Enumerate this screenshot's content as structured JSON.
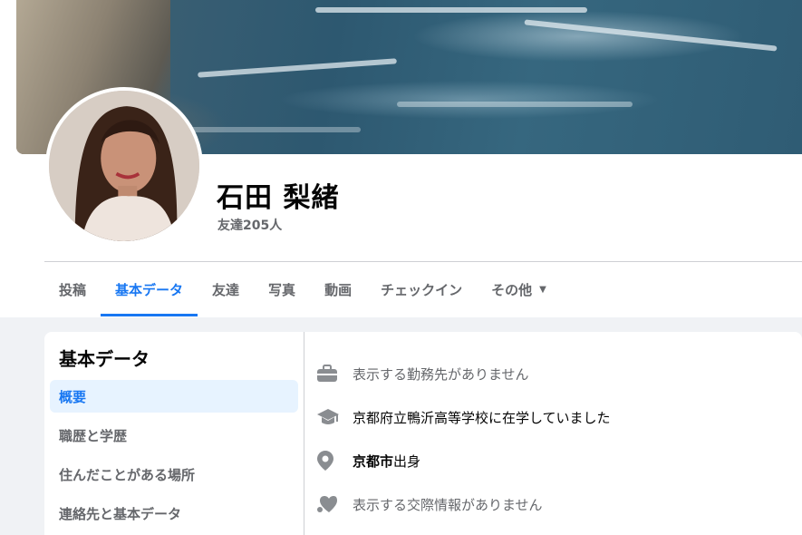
{
  "profile": {
    "name": "石田 梨緒",
    "friends": "友達205人"
  },
  "tabs": [
    {
      "label": "投稿",
      "active": false
    },
    {
      "label": "基本データ",
      "active": true
    },
    {
      "label": "友達",
      "active": false
    },
    {
      "label": "写真",
      "active": false
    },
    {
      "label": "動画",
      "active": false
    },
    {
      "label": "チェックイン",
      "active": false
    },
    {
      "label": "その他",
      "active": false,
      "icon": "caret-down-icon"
    }
  ],
  "about": {
    "title": "基本データ",
    "nav": [
      {
        "label": "概要",
        "active": true
      },
      {
        "label": "職歴と学歴",
        "active": false
      },
      {
        "label": "住んだことがある場所",
        "active": false
      },
      {
        "label": "連絡先と基本データ",
        "active": false
      }
    ],
    "info": {
      "work": {
        "icon": "briefcase-icon",
        "text": "表示する勤務先がありません"
      },
      "education": {
        "icon": "graduation-cap-icon",
        "text": "京都府立鴨沂高等学校に在学していました"
      },
      "hometown": {
        "icon": "location-pin-icon",
        "place": "京都市",
        "suffix": "出身"
      },
      "relationship": {
        "icon": "heart-icon",
        "text": "表示する交際情報がありません"
      }
    }
  },
  "colors": {
    "accent": "#1877f2",
    "muted": "#65676b",
    "active_bg": "#e7f3ff"
  }
}
